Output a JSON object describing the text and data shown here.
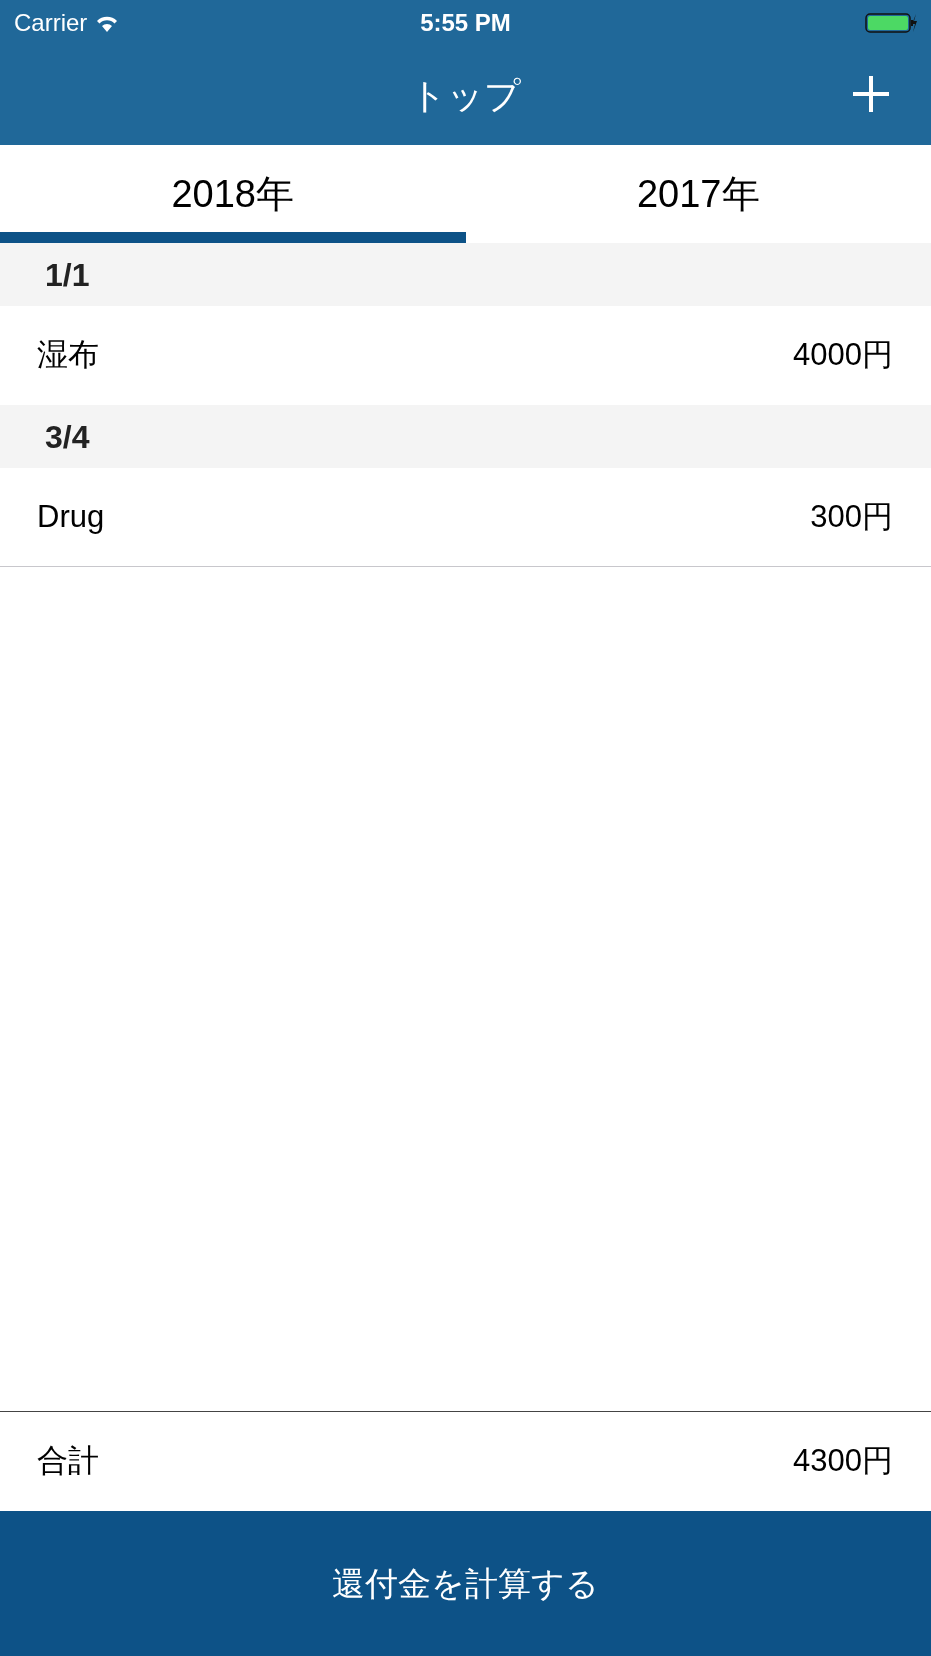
{
  "status_bar": {
    "carrier": "Carrier",
    "time": "5:55 PM"
  },
  "nav": {
    "title": "トップ"
  },
  "tabs": [
    {
      "label": "2018年",
      "selected": true
    },
    {
      "label": "2017年",
      "selected": false
    }
  ],
  "sections": [
    {
      "date": "1/1",
      "items": [
        {
          "name": "湿布",
          "amount": "4000円"
        }
      ]
    },
    {
      "date": "3/4",
      "items": [
        {
          "name": "Drug",
          "amount": "300円"
        }
      ]
    }
  ],
  "total": {
    "label": "合計",
    "amount": "4300円"
  },
  "action_button": {
    "label": "還付金を計算する"
  }
}
